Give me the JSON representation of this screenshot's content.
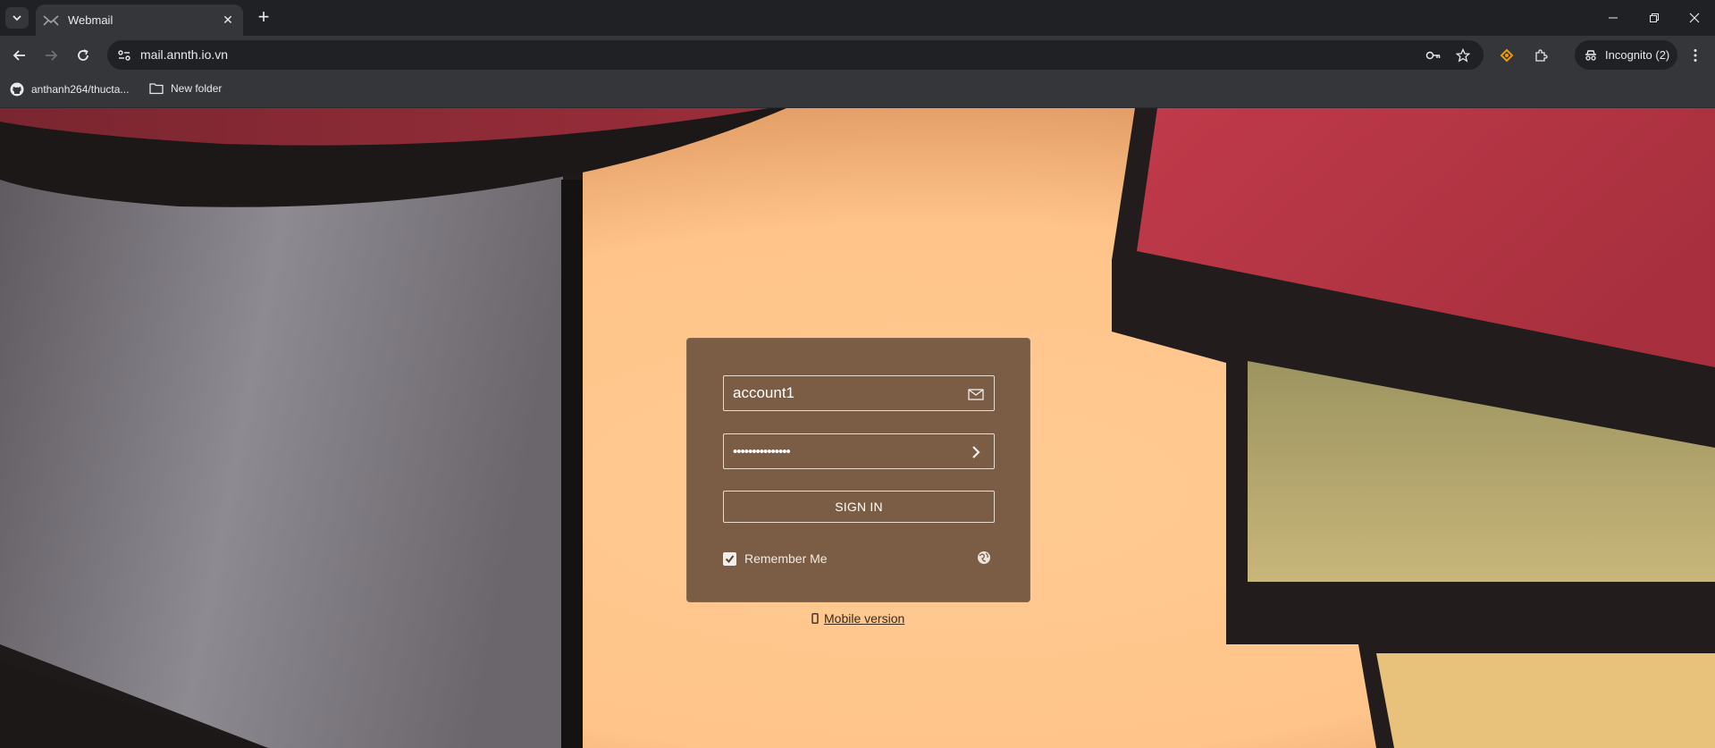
{
  "browser": {
    "tab_title": "Webmail",
    "url": "mail.annth.io.vn",
    "incognito_label": "Incognito (2)",
    "bookmarks": [
      {
        "label": "anthanh264/thucta..."
      },
      {
        "label": "New folder"
      }
    ]
  },
  "login": {
    "username_value": "account1",
    "password_value": "•••••••••••••••",
    "signin_label": "SIGN IN",
    "remember_label": "Remember Me",
    "remember_checked": true,
    "mobile_label": "Mobile version"
  },
  "icons": {
    "username": "envelope-icon",
    "password": "chevron-right-icon",
    "language": "globe-icon",
    "mobile": "phone-icon"
  },
  "colors": {
    "panel": "#7a5d44",
    "background": "#ffc88f",
    "accent_red": "#b3364a"
  }
}
